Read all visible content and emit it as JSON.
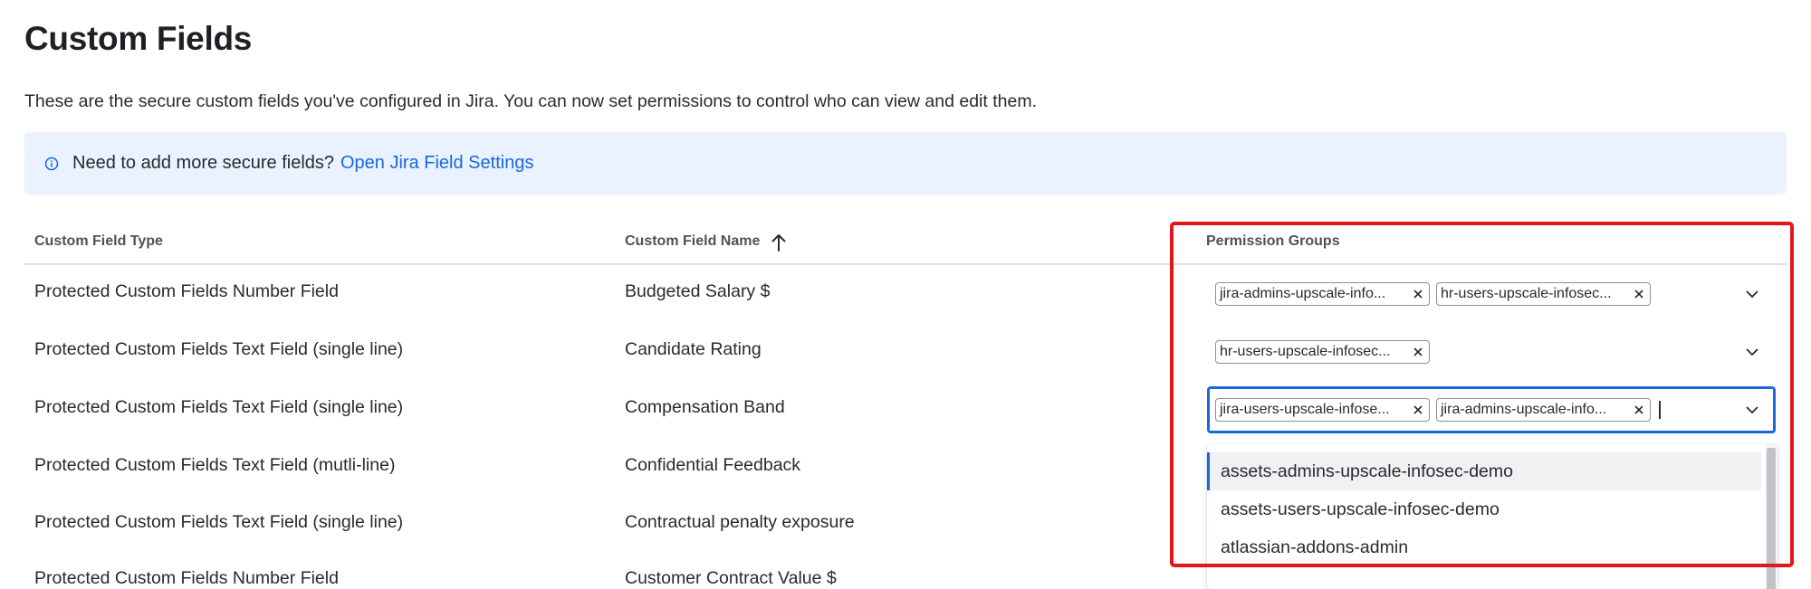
{
  "page": {
    "title": "Custom Fields",
    "description": "These are the secure custom fields you've configured in Jira. You can now set permissions to control who can view and edit them."
  },
  "banner": {
    "text": "Need to add more secure fields?",
    "link": "Open Jira Field Settings",
    "icon": "info-icon",
    "background": "#e9f2fe",
    "link_color": "#1868db"
  },
  "table": {
    "columns": [
      "Custom Field Type",
      "Custom Field Name",
      "Permission Groups"
    ],
    "sort": {
      "column": "Custom Field Name",
      "direction": "ascending",
      "icon": "arrow-up-icon"
    },
    "rows": [
      {
        "type": "Protected Custom Fields Number Field",
        "name": "Budgeted Salary $",
        "groups": [
          "jira-admins-upscale-info...",
          "hr-users-upscale-infosec..."
        ]
      },
      {
        "type": "Protected Custom Fields Text Field (single line)",
        "name": "Candidate Rating",
        "groups": [
          "hr-users-upscale-infosec..."
        ]
      },
      {
        "type": "Protected Custom Fields Text Field (single line)",
        "name": "Compensation Band",
        "groups": [
          "jira-users-upscale-infose...",
          "jira-admins-upscale-info..."
        ]
      },
      {
        "type": "Protected Custom Fields Text Field (mutli-line)",
        "name": "Confidential Feedback",
        "groups": []
      },
      {
        "type": "Protected Custom Fields Text Field (single line)",
        "name": "Contractual penalty exposure",
        "groups": []
      },
      {
        "type": "Protected Custom Fields Number Field",
        "name": "Customer Contract Value $",
        "groups": []
      }
    ]
  },
  "dropdown": {
    "options": [
      "assets-admins-upscale-infosec-demo",
      "assets-users-upscale-infosec-demo",
      "atlassian-addons-admin"
    ],
    "highlighted_index": 0
  },
  "colors": {
    "focus": "#1868db",
    "annotation": "#e3161b",
    "text": "#292a2e",
    "header_text": "#505258"
  }
}
